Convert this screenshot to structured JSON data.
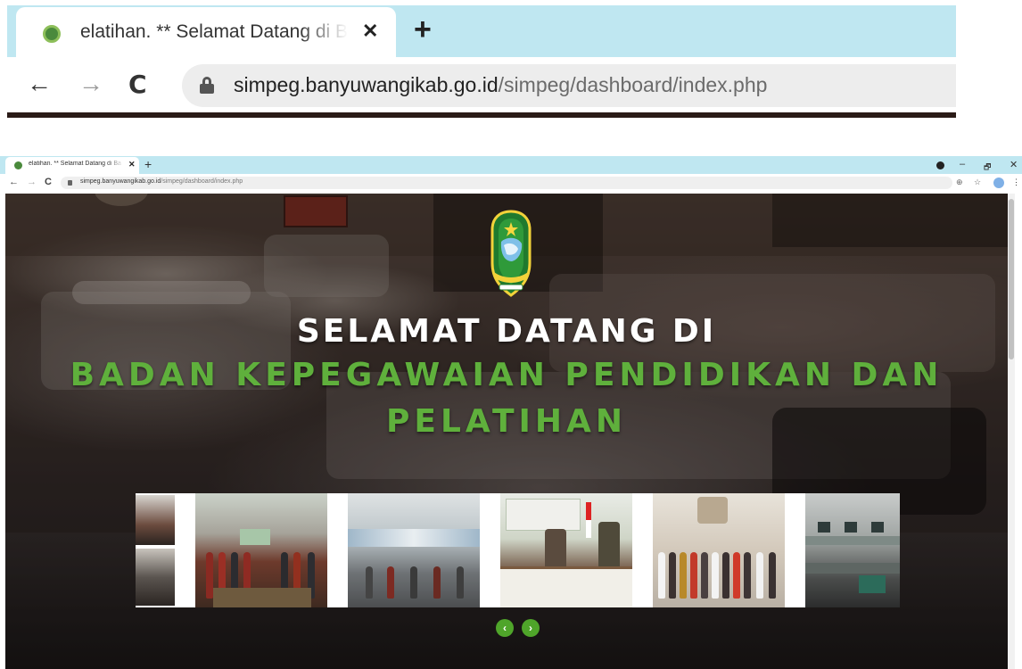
{
  "zoom_chrome": {
    "tab_title": "elatihan. ** Selamat Datang di Ba",
    "tab_close": "✕",
    "new_tab": "+",
    "back": "←",
    "forward": "→",
    "reload": "C",
    "url_host": "simpeg.banyuwangikab.go.id",
    "url_path": "/simpeg/dashboard/index.php"
  },
  "browser": {
    "tab_title": "elatihan. ** Selamat Datang di Ba",
    "tab_close": "✕",
    "new_tab": "+",
    "minimize": "–",
    "maximize": "🗗",
    "close": "✕",
    "back": "←",
    "forward": "→",
    "reload": "C",
    "url_host": "simpeg.banyuwangikab.go.id",
    "url_path": "/simpeg/dashboard/index.php",
    "zoom_icon": "⊕",
    "star_icon": "☆",
    "menu_icon": "⋮"
  },
  "hero": {
    "line1": "SELAMAT DATANG DI",
    "line2": "BADAN KEPEGAWAIAN PENDIDIKAN DAN",
    "line3": "PELATIHAN"
  },
  "gallery": {
    "prev_label": "‹",
    "next_label": "›"
  },
  "colors": {
    "tabstrip": "#bfe7f1",
    "accent_green": "#5fb03c",
    "button_green": "#4fa52a"
  }
}
